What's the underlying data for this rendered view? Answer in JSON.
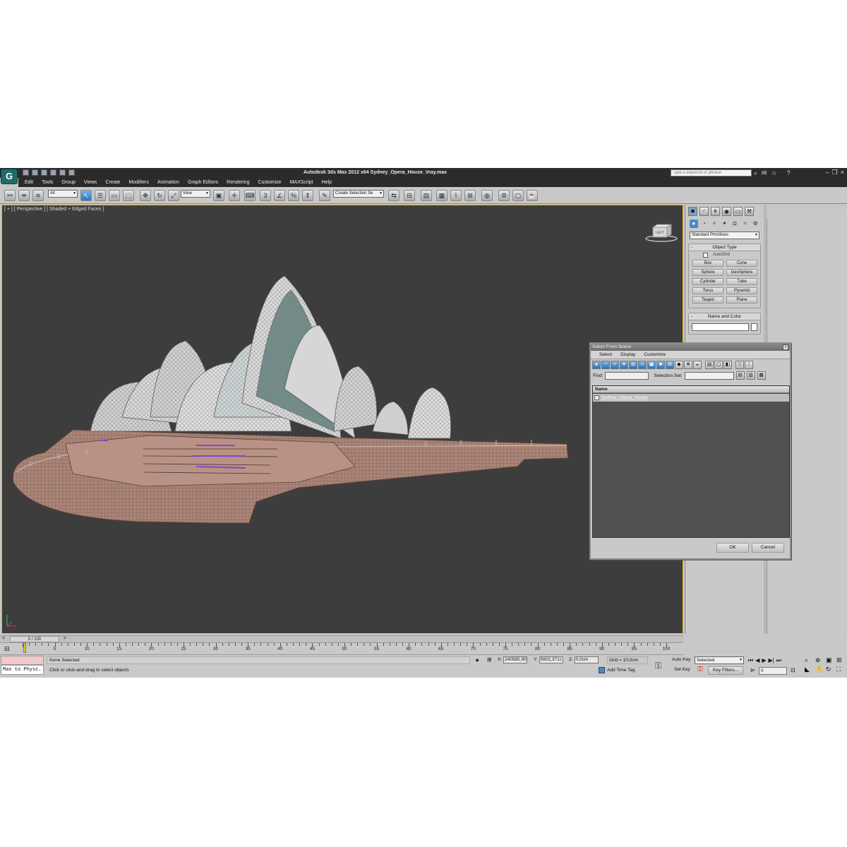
{
  "app": {
    "title": "Autodesk 3ds Max  2012 x64     Sydney_Opera_House_Vray.max",
    "logo": "G",
    "search_placeholder": "Type a keyword or phrase"
  },
  "menu": [
    "Edit",
    "Tools",
    "Group",
    "Views",
    "Create",
    "Modifiers",
    "Animation",
    "Graph Editors",
    "Rendering",
    "Customize",
    "MAXScript",
    "Help"
  ],
  "toolbar": {
    "filter_value": "All",
    "coord_value": "View",
    "selection_set_value": "Create Selection Se",
    "snap_label": "3"
  },
  "viewport": {
    "label": "[ + ] [ Perspective ] [ Shaded + Edged Faces ]",
    "viewcube_label": "LEFT"
  },
  "command_panel": {
    "category": "Standard Primitives",
    "object_type_title": "Object Type",
    "autogrid_label": "AutoGrid",
    "object_buttons": [
      "Box",
      "Cone",
      "Sphere",
      "GeoSphere",
      "Cylinder",
      "Tube",
      "Torus",
      "Pyramid",
      "Teapot",
      "Plane"
    ],
    "name_color_title": "Name and Color"
  },
  "dialog": {
    "title": "Select From Scene",
    "close": "x",
    "menu": [
      "Select",
      "Display",
      "Customize"
    ],
    "find_label": "Find:",
    "selection_set_label": "Selection Set:",
    "column_name": "Name",
    "items": [
      "Sydney_Opera_House"
    ],
    "ok_label": "OK",
    "cancel_label": "Cancel"
  },
  "timeline": {
    "frame_display": "0 / 100",
    "ticks": [
      "5",
      "10",
      "15",
      "20",
      "25",
      "30",
      "35",
      "40",
      "45",
      "50",
      "55",
      "60",
      "65",
      "70",
      "75",
      "80",
      "85",
      "90",
      "95",
      "100"
    ]
  },
  "status": {
    "maxscript_text": "Max to Physc.",
    "selection_status": "None Selected",
    "prompt": "Click or click-and-drag to select objects",
    "x_label": "X:",
    "x_value": "240565,90",
    "y_label": "Y:",
    "y_value": "5602,371c",
    "z_label": "Z:",
    "z_value": "0,0cm",
    "grid": "Grid = 10,0cm",
    "add_time_tag": "Add Time Tag",
    "auto_key": "Auto Key",
    "set_key": "Set Key",
    "selected_value": "Selected",
    "key_filters": "Key Filters...",
    "frame_value": "0"
  }
}
